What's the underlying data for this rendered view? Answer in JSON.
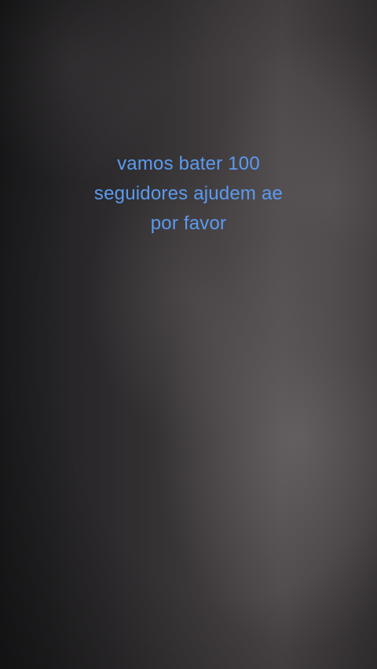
{
  "caption": {
    "line1": "vamos bater 100",
    "line2": "seguidores ajudem ae",
    "line3": "por favor"
  },
  "colors": {
    "caption_text": "#5b9bf0",
    "background_dark": "#1c1b1d",
    "background_light": "#4b4648"
  }
}
